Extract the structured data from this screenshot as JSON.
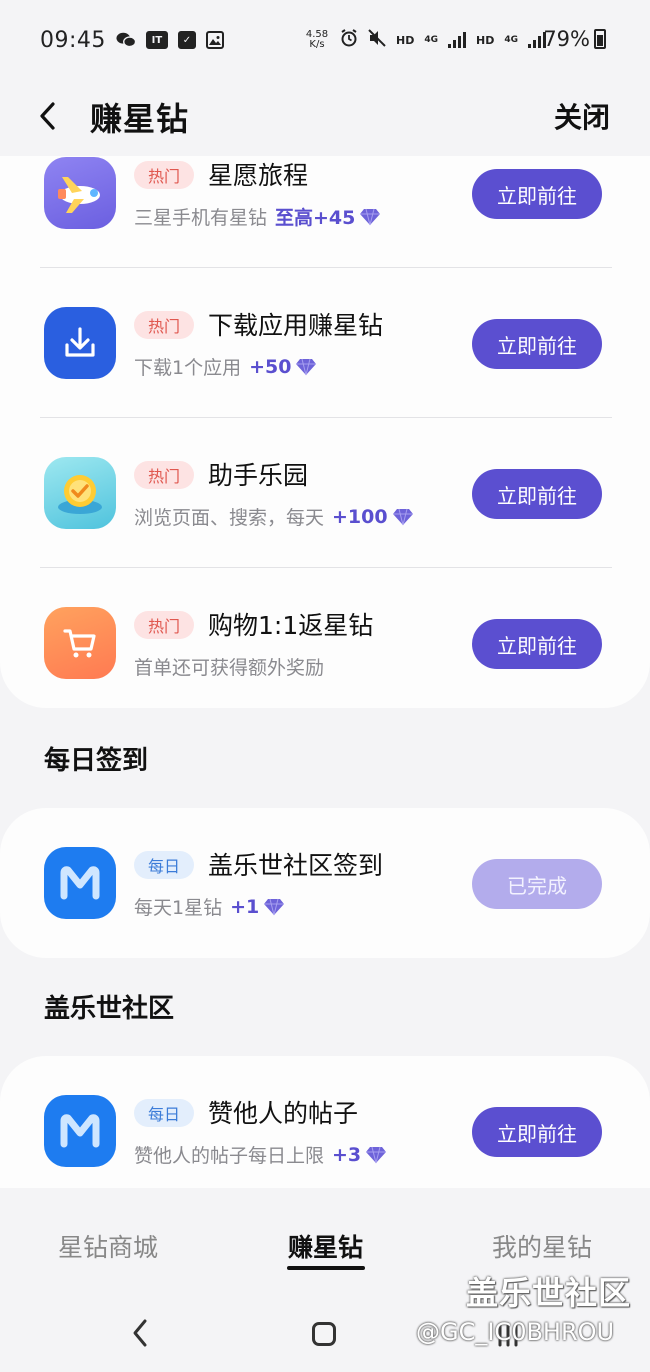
{
  "status_bar": {
    "time": "09:45",
    "net_speed_value": "4.58",
    "net_speed_unit": "K/s",
    "hd1": "HD",
    "lte1": "4G",
    "hd2": "HD",
    "lte2": "4G",
    "battery": "79%",
    "left_icons": [
      "wechat-icon",
      "it-icon",
      "check-box-icon",
      "image-icon"
    ],
    "right_icons": [
      "alarm-icon",
      "mute-icon",
      "signal-icon",
      "battery-icon"
    ]
  },
  "header": {
    "title": "赚星钻",
    "close_label": "关闭"
  },
  "tasks_top": [
    {
      "tag": "热门",
      "title": "星愿旅程",
      "desc": "三星手机有星钻",
      "reward": "至高+45",
      "button": "立即前往",
      "icon": "airplane-icon"
    },
    {
      "tag": "热门",
      "title": "下载应用赚星钻",
      "desc": "下载1个应用",
      "reward": "+50",
      "button": "立即前往",
      "icon": "download-icon"
    },
    {
      "tag": "热门",
      "title": "助手乐园",
      "desc": "浏览页面、搜索，每天",
      "reward": "+100",
      "button": "立即前往",
      "icon": "assistant-badge-icon"
    },
    {
      "tag": "热门",
      "title": "购物1:1返星钻",
      "desc": "首单还可获得额外奖励",
      "reward": "",
      "button": "立即前往",
      "icon": "shopping-cart-icon"
    }
  ],
  "daily_section": {
    "title": "每日签到",
    "task": {
      "tag": "每日",
      "title": "盖乐世社区签到",
      "desc": "每天1星钻",
      "reward": "+1",
      "button": "已完成",
      "icon": "members-m-icon"
    }
  },
  "community_section": {
    "title": "盖乐世社区",
    "task": {
      "tag": "每日",
      "title": "赞他人的帖子",
      "desc": "赞他人的帖子每日上限",
      "reward": "+3",
      "button": "立即前往",
      "icon": "members-m-icon"
    }
  },
  "bottom_nav": {
    "items": [
      "星钻商城",
      "赚星钻",
      "我的星钻"
    ],
    "active": "赚星钻"
  },
  "watermark": {
    "line1": "盖乐世社区",
    "line2": "@GC_IC0BHROU"
  },
  "colors": {
    "accent": "#5b4fd0",
    "accent_done": "#b3acec",
    "hot_tag_bg": "#fde3e3",
    "hot_tag_text": "#e0574f",
    "daily_tag_bg": "#e3eefc",
    "daily_tag_text": "#3c7cd8",
    "gem": "#6e63d9"
  }
}
